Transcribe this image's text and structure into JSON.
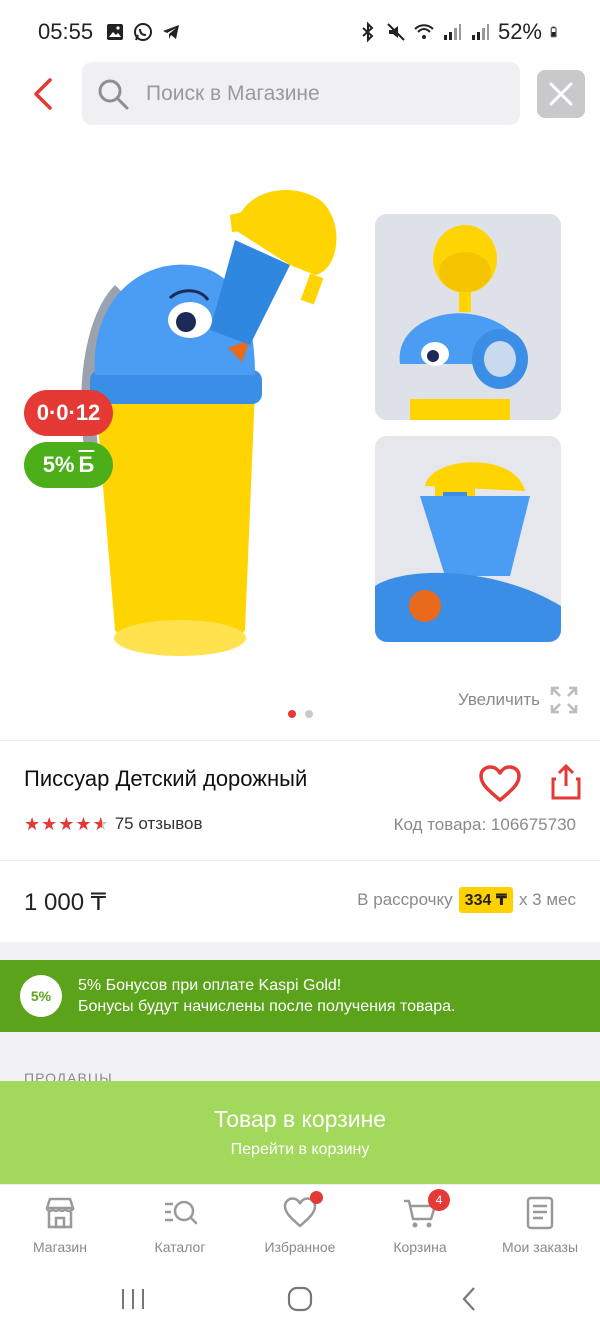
{
  "status_bar": {
    "time": "05:55",
    "battery": "52%"
  },
  "search": {
    "placeholder": "Поиск в Магазине"
  },
  "gallery": {
    "timer_badge": "0·0·12",
    "bonus_badge_percent": "5%",
    "bonus_badge_symbol": "Б",
    "zoom_label": "Увеличить",
    "page_count": 2,
    "active_page": 1
  },
  "product": {
    "title": "Писсуар Детский дорожный",
    "rating_stars": 4.5,
    "reviews": "75 отзывов",
    "sku": "Код товара: 106675730",
    "price": "1 000 ₸",
    "installment_prefix": "В рассрочку",
    "installment_amount": "334 ₸",
    "installment_suffix": "x 3 мес"
  },
  "bonus_banner": {
    "circle": "5%",
    "line1": "5% Бонусов при оплате Kaspi Gold!",
    "line2": "Бонусы будут начислены после получения товара."
  },
  "sellers": {
    "label": "ПРОДАВЦЫ"
  },
  "cart_cta": {
    "title": "Товар в корзине",
    "subtitle": "Перейти в корзину"
  },
  "bottom_nav": {
    "items": [
      {
        "label": "Магазин",
        "icon": "store-icon"
      },
      {
        "label": "Каталог",
        "icon": "catalog-icon"
      },
      {
        "label": "Избранное",
        "icon": "heart-icon"
      },
      {
        "label": "Корзина",
        "icon": "cart-icon"
      },
      {
        "label": "Мои заказы",
        "icon": "orders-icon"
      }
    ],
    "cart_count": "4"
  },
  "colors": {
    "accent_red": "#e53935",
    "bonus_green": "#5ba31a",
    "cta_green": "#a2d95c",
    "installment_yellow": "#ffd100"
  }
}
